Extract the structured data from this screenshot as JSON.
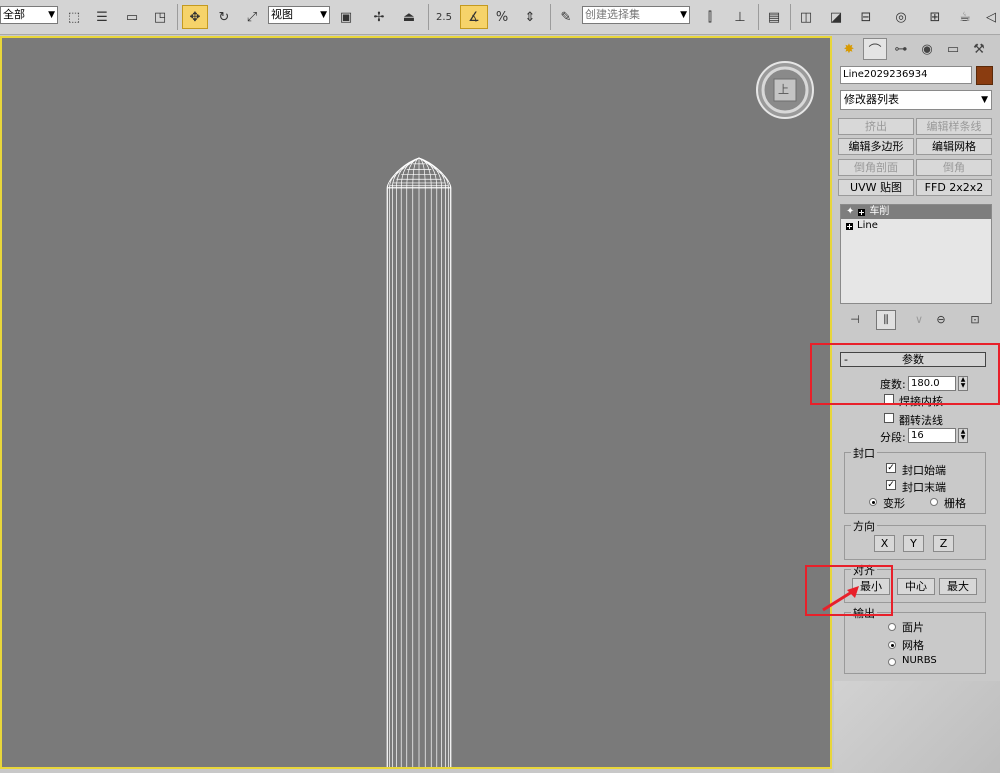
{
  "toolbar": {
    "selection_filter": "全部",
    "ref_coord": "视图",
    "snap_value": "2.5",
    "named_selection_placeholder": "创建选择集"
  },
  "viewport": {
    "viewcube_label": "上"
  },
  "panel": {
    "object_name": "Line2029236934",
    "object_color": "#8a3c10",
    "modifier_list": "修改器列表",
    "modifier_buttons": [
      {
        "label": "挤出",
        "enabled": false
      },
      {
        "label": "编辑样条线",
        "enabled": false
      },
      {
        "label": "编辑多边形",
        "enabled": true
      },
      {
        "label": "编辑网格",
        "enabled": true
      },
      {
        "label": "倒角剖面",
        "enabled": false
      },
      {
        "label": "倒角",
        "enabled": false
      },
      {
        "label": "UVW 贴图",
        "enabled": true
      },
      {
        "label": "FFD 2x2x2",
        "enabled": true
      }
    ],
    "stack": [
      {
        "label": "车削",
        "active": true
      },
      {
        "label": "Line",
        "active": false
      }
    ],
    "params": {
      "title": "参数",
      "collapse": "-",
      "degrees_label": "度数:",
      "degrees_value": "180.0",
      "weld_core_label": "焊接内核",
      "flip_normals_label": "翻转法线",
      "segments_label": "分段:",
      "segments_value": "16",
      "capping_title": "封口",
      "cap_start_label": "封口始端",
      "cap_end_label": "封口末端",
      "morph_label": "变形",
      "grid_label": "栅格",
      "direction_title": "方向",
      "dir_x": "X",
      "dir_y": "Y",
      "dir_z": "Z",
      "align_title": "对齐",
      "align_min": "最小",
      "align_center": "中心",
      "align_max": "最大",
      "output_title": "输出",
      "out_patch": "面片",
      "out_mesh": "网格",
      "out_nurbs": "NURBS"
    }
  }
}
